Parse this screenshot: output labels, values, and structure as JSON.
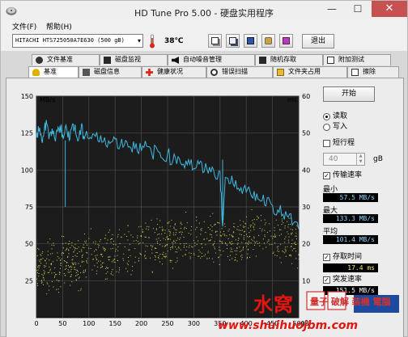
{
  "window": {
    "title": "HD Tune Pro 5.00 - 硬盘实用程序",
    "controls": {
      "minimize": "—",
      "maximize": "☐",
      "close": "✕"
    }
  },
  "menu": {
    "file": "文件(F)",
    "help": "帮助(H)"
  },
  "toolbar": {
    "drive": "HITACHI HTS725050A7E630 (500 gB)",
    "temperature": "38℃",
    "exit_label": "退出",
    "icons": [
      "copy-icon",
      "copy2-icon",
      "save-icon",
      "camera-icon",
      "download-icon"
    ]
  },
  "tabs_row1": [
    {
      "label": "文件基准",
      "icon": "file-benchmark-icon"
    },
    {
      "label": "磁盘监视",
      "icon": "monitor-icon"
    },
    {
      "label": "自动噪音管理",
      "icon": "aam-icon"
    },
    {
      "label": "随机存取",
      "icon": "random-access-icon"
    },
    {
      "label": "附加测试",
      "icon": "extra-tests-icon"
    }
  ],
  "tabs_row2": [
    {
      "label": "基准",
      "icon": "benchmark-icon",
      "active": true
    },
    {
      "label": "磁盘信息",
      "icon": "info-icon"
    },
    {
      "label": "健康状况",
      "icon": "health-icon"
    },
    {
      "label": "错误扫描",
      "icon": "scan-icon"
    },
    {
      "label": "文件夹占用",
      "icon": "folder-icon"
    },
    {
      "label": "擦除",
      "icon": "erase-icon"
    }
  ],
  "controls": {
    "start_label": "开始",
    "read_label": "读取",
    "write_label": "写入",
    "short_stroke_label": "短行程",
    "short_stroke_value": "40",
    "short_stroke_unit": "gB",
    "transfer_rate_label": "传输速率",
    "min_label": "最小",
    "min_value": "57.5 MB/s",
    "max_label": "最大",
    "max_value": "133.3 MB/s",
    "avg_label": "平均",
    "avg_value": "101.4 MB/s",
    "access_time_label": "存取时间",
    "access_time_value": "17.4 ms",
    "burst_rate_label": "突发速率",
    "burst_rate_value": "151.5 MB/s"
  },
  "watermark": {
    "brand": "水窝",
    "logo_text": "量子 破解 装機 電腦",
    "url": "www.shuihuojbm.com"
  },
  "colors": {
    "chart_bg": "#1c1c1c",
    "grid": "#4a4a4a",
    "transfer_line": "#3fb8e0",
    "access_dots": "#d8d84a"
  },
  "chart_data": {
    "type": "line",
    "xlabel": "gB",
    "x_ticks": [
      "0",
      "50",
      "100",
      "150",
      "200",
      "250",
      "300",
      "350",
      "400",
      "450",
      "500"
    ],
    "y_left_unit": "MB/s",
    "y_left_ticks": [
      "150",
      "125",
      "100",
      "75",
      "50",
      "25"
    ],
    "y_left_range": [
      0,
      150
    ],
    "y_right_unit": "ms",
    "y_right_ticks": [
      "60",
      "50",
      "40",
      "30",
      "20",
      "10"
    ],
    "y_right_range": [
      0,
      60
    ],
    "grid": true,
    "series": [
      {
        "name": "传输速率",
        "axis": "left",
        "x": [
          0,
          5,
          10,
          15,
          20,
          25,
          30,
          35,
          40,
          45,
          50,
          55,
          60,
          65,
          70,
          75,
          80,
          85,
          90,
          95,
          100,
          110,
          120,
          130,
          140,
          150,
          160,
          170,
          180,
          190,
          200,
          210,
          220,
          230,
          240,
          250,
          260,
          270,
          280,
          290,
          300,
          310,
          320,
          330,
          340,
          350,
          355,
          360,
          370,
          380,
          390,
          400,
          410,
          420,
          430,
          440,
          450,
          460,
          470,
          480,
          490,
          500
        ],
        "y": [
          122,
          126,
          120,
          127,
          131,
          124,
          128,
          121,
          126,
          130,
          124,
          129,
          122,
          127,
          131,
          125,
          120,
          128,
          123,
          126,
          121,
          124,
          119,
          122,
          118,
          121,
          117,
          120,
          115,
          118,
          113,
          116,
          111,
          114,
          108,
          111,
          106,
          109,
          104,
          107,
          101,
          104,
          99,
          102,
          96,
          99,
          62,
          95,
          91,
          93,
          88,
          85,
          82,
          84,
          79,
          81,
          76,
          73,
          70,
          68,
          64,
          60
        ]
      },
      {
        "name": "存取时间",
        "axis": "right",
        "x": [
          10,
          20,
          30,
          40,
          50,
          60,
          70,
          80,
          90,
          100,
          120,
          140,
          160,
          180,
          200,
          220,
          240,
          260,
          280,
          300,
          320,
          340,
          360,
          380,
          400,
          420,
          440,
          460,
          480,
          500
        ],
        "y": [
          13,
          14,
          15,
          13,
          16,
          15,
          17,
          14,
          16,
          17,
          18,
          17,
          19,
          18,
          20,
          19,
          21,
          20,
          22,
          21,
          20,
          22,
          21,
          20,
          22,
          23,
          21,
          22,
          21,
          20
        ]
      }
    ],
    "dips": [
      {
        "x": 55,
        "y": 75
      },
      {
        "x": 355,
        "y": 62
      }
    ]
  }
}
